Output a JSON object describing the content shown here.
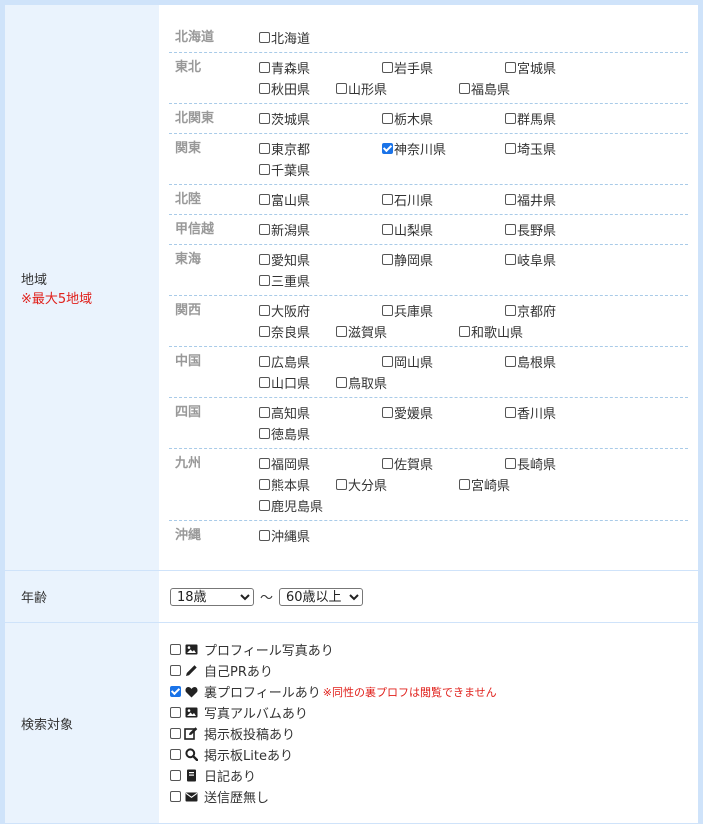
{
  "region": {
    "label": "地域",
    "note": "※最大5地域",
    "groups": [
      {
        "name": "北海道",
        "prefs": [
          {
            "name": "北海道",
            "checked": false
          }
        ]
      },
      {
        "name": "東北",
        "prefs": [
          {
            "name": "青森県",
            "checked": false
          },
          {
            "name": "岩手県",
            "checked": false
          },
          {
            "name": "宮城県",
            "checked": false
          },
          {
            "name": "秋田県",
            "checked": false
          },
          {
            "name": "山形県",
            "checked": false
          },
          {
            "name": "福島県",
            "checked": false
          }
        ]
      },
      {
        "name": "北関東",
        "prefs": [
          {
            "name": "茨城県",
            "checked": false
          },
          {
            "name": "栃木県",
            "checked": false
          },
          {
            "name": "群馬県",
            "checked": false
          }
        ]
      },
      {
        "name": "関東",
        "prefs": [
          {
            "name": "東京都",
            "checked": false
          },
          {
            "name": "神奈川県",
            "checked": true
          },
          {
            "name": "埼玉県",
            "checked": false
          },
          {
            "name": "千葉県",
            "checked": false
          }
        ]
      },
      {
        "name": "北陸",
        "prefs": [
          {
            "name": "富山県",
            "checked": false
          },
          {
            "name": "石川県",
            "checked": false
          },
          {
            "name": "福井県",
            "checked": false
          }
        ]
      },
      {
        "name": "甲信越",
        "prefs": [
          {
            "name": "新潟県",
            "checked": false
          },
          {
            "name": "山梨県",
            "checked": false
          },
          {
            "name": "長野県",
            "checked": false
          }
        ]
      },
      {
        "name": "東海",
        "prefs": [
          {
            "name": "愛知県",
            "checked": false
          },
          {
            "name": "静岡県",
            "checked": false
          },
          {
            "name": "岐阜県",
            "checked": false
          },
          {
            "name": "三重県",
            "checked": false
          }
        ]
      },
      {
        "name": "関西",
        "prefs": [
          {
            "name": "大阪府",
            "checked": false
          },
          {
            "name": "兵庫県",
            "checked": false
          },
          {
            "name": "京都府",
            "checked": false
          },
          {
            "name": "奈良県",
            "checked": false
          },
          {
            "name": "滋賀県",
            "checked": false
          },
          {
            "name": "和歌山県",
            "checked": false
          }
        ]
      },
      {
        "name": "中国",
        "prefs": [
          {
            "name": "広島県",
            "checked": false
          },
          {
            "name": "岡山県",
            "checked": false
          },
          {
            "name": "島根県",
            "checked": false
          },
          {
            "name": "山口県",
            "checked": false
          },
          {
            "name": "鳥取県",
            "checked": false
          }
        ]
      },
      {
        "name": "四国",
        "prefs": [
          {
            "name": "高知県",
            "checked": false
          },
          {
            "name": "愛媛県",
            "checked": false
          },
          {
            "name": "香川県",
            "checked": false
          },
          {
            "name": "徳島県",
            "checked": false
          }
        ]
      },
      {
        "name": "九州",
        "prefs": [
          {
            "name": "福岡県",
            "checked": false
          },
          {
            "name": "佐賀県",
            "checked": false
          },
          {
            "name": "長崎県",
            "checked": false
          },
          {
            "name": "熊本県",
            "checked": false
          },
          {
            "name": "大分県",
            "checked": false
          },
          {
            "name": "宮崎県",
            "checked": false
          },
          {
            "name": "鹿児島県",
            "checked": false
          }
        ]
      },
      {
        "name": "沖縄",
        "prefs": [
          {
            "name": "沖縄県",
            "checked": false
          }
        ]
      }
    ]
  },
  "age": {
    "label": "年齢",
    "min_value": "18歳",
    "separator": "〜",
    "max_value": "60歳以上"
  },
  "search_target": {
    "label": "検索対象",
    "options": [
      {
        "label": "プロフィール写真あり",
        "icon": "image-icon",
        "checked": false,
        "note": ""
      },
      {
        "label": "自己PRあり",
        "icon": "pencil-icon",
        "checked": false,
        "note": ""
      },
      {
        "label": "裏プロフィールあり",
        "icon": "heart-icon",
        "checked": true,
        "note": "※同性の裏プロフは閲覧できません"
      },
      {
        "label": "写真アルバムあり",
        "icon": "image-icon",
        "checked": false,
        "note": ""
      },
      {
        "label": "掲示板投稿あり",
        "icon": "edit-icon",
        "checked": false,
        "note": ""
      },
      {
        "label": "掲示板Liteあり",
        "icon": "search-icon",
        "checked": false,
        "note": ""
      },
      {
        "label": "日記あり",
        "icon": "book-icon",
        "checked": false,
        "note": ""
      },
      {
        "label": "送信歴無し",
        "icon": "envelope-icon",
        "checked": false,
        "note": ""
      }
    ]
  },
  "colors": {
    "accent": "#1a73e8",
    "note_red": "#e0201b",
    "header_bg": "#eaf3fd",
    "border": "#cfe3fa",
    "dashed": "#a9cbe8"
  }
}
